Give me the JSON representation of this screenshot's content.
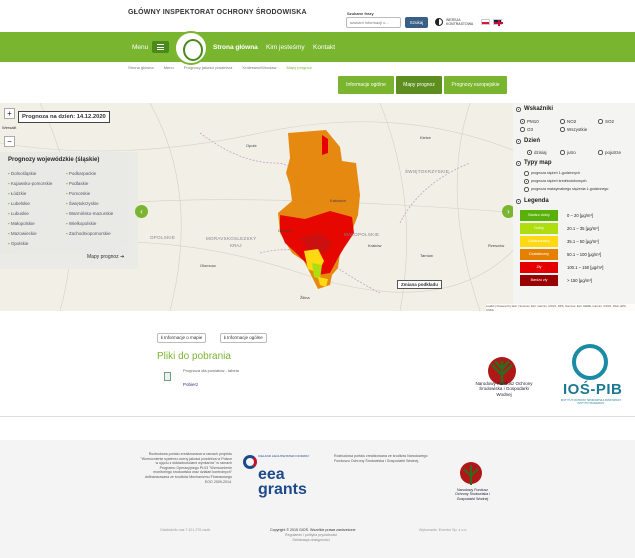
{
  "header": {
    "title": "GŁÓWNY INSPEKTORAT OCHRONY ŚRODOWISKA",
    "search_label": "Szukane frazy",
    "search_placeholder": "szukam informacji o...",
    "search_button": "Szukaj",
    "contrast_label": "WERSJA KONTRASTOWA"
  },
  "nav": {
    "menu": "Menu",
    "items": [
      "Strona główna",
      "Kim jesteśmy",
      "Kontakt"
    ]
  },
  "breadcrumb": [
    "Strona główna",
    "Menu",
    "Prognozy jakości powietrza",
    "Królestwo/Wrocław",
    "Mapy prognoz"
  ],
  "tabs": [
    "Informacje ogólne",
    "Mapy prognoz",
    "Prognozy europejskie"
  ],
  "map": {
    "forecast_date": "Prognoza na dzień: 14.12.2020",
    "zoom_in": "+",
    "zoom_out": "−",
    "lang_word": "Wersalit",
    "change_basemap": "Zmiana podkładu",
    "attribution": "Leaflet | Powered by Esri | Sources: Esri, Garmin, USGS, NPS; Sources: Esri, HERE, Garmin, USGS, NGA, EPA, USDA",
    "place_labels": [
      "OPOLSKIE",
      "ŚWIĘTOKRZYSKIE",
      "MORAVSKOSLEZSKÝ",
      "KRAJ",
      "MAŁOPOLSKIE",
      "Kraków",
      "Opole",
      "Katowice",
      "Kielce",
      "Ostrava",
      "Olomouc",
      "Žilina",
      "Tarnów",
      "Rzeszów"
    ]
  },
  "voivodeships": {
    "title": "Prognozy wojewódzkie (śląskie)",
    "col1": [
      "Dolnośląskie",
      "Kujawsko-pomorskie",
      "Łódzkie",
      "Lubelskie",
      "Lubuskie",
      "Małopolskie",
      "Mazowieckie",
      "Opolskie"
    ],
    "col2": [
      "Podkarpackie",
      "Podlaskie",
      "Pomorskie",
      "Świętokrzyskie",
      "Warmińsko-mazurskie",
      "Wielkopolskie",
      "Zachodniopomorskie"
    ],
    "maps_link": "Mapy prognoz ➔"
  },
  "panel": {
    "indicators_title": "Wskaźniki",
    "indicators": [
      "PM10",
      "NO2",
      "SO2",
      "O3",
      "Wszystkie"
    ],
    "day_title": "Dzień",
    "days": [
      "dzisiaj",
      "jutro",
      "pojutrze"
    ],
    "map_types_title": "Typy map",
    "map_types": [
      "prognoza stężeń 1-godzinnych",
      "prognoza stężeń średniodobowych",
      "prognoza maksymalnego stężenia 1-godzinnego"
    ],
    "legend_title": "Legenda",
    "legend": [
      {
        "label": "Bardzo dobry",
        "value": "0 – 20 [μg/m³]",
        "color": "#57b108"
      },
      {
        "label": "Dobry",
        "value": "20.1 – 35 [μg/m³]",
        "color": "#b0dd10"
      },
      {
        "label": "Umiarkowany",
        "value": "35.1 – 50 [μg/m³]",
        "color": "#ffd911"
      },
      {
        "label": "Dostateczny",
        "value": "50.1 – 100 [μg/m³]",
        "color": "#e58100"
      },
      {
        "label": "Zły",
        "value": "100.1 – 150 [μg/m³]",
        "color": "#e50000"
      },
      {
        "label": "Bardzo zły",
        "value": "> 150 [μg/m³]",
        "color": "#990000"
      }
    ]
  },
  "content": {
    "info_map_btn": "ℹ Informacje o mapie",
    "info_general_btn": "ℹ Informacje ogólne",
    "downloads_title": "Pliki do pobrania",
    "doc_link": "Prognoza dla powiatów - tabela",
    "download_link": "Pobierz",
    "nfos_text": "Narodowy Fundusz Ochrony Środowiska i Gospodarki Wodnej",
    "ios_text": "IOŚ-PIB",
    "ios_sub": "INSTYTUT OCHRONY ŚRODOWISKA PAŃSTWOWY INSTYTUT BADAWCZY"
  },
  "footer": {
    "left_text": "Rozbudowa portalu zrealizowana w ramach projektu \"Wzmocnienie systemu oceny jakości powietrza w Polsce w ujęciu z dokładnościami wymiarów\" w ramach Programu Operacyjnego PL03 \"Wzmocnienie monitoringu środowiska oraz działań kontrolnych\" dofinansowana ze środków Mechanizmu Finansowego EOG 2009-2014.",
    "eea_small": "ICELAND LIECHTENSTEIN NORWAY",
    "eea_text": "eea\ngrants",
    "mid_text": "Rozbudowa portalu zrealizowana ze środków Narodowego Funduszu Ochrony Środowiska i Gospodarki Wodnej.",
    "nfos_small": "Narodowy Fundusz Ochrony Środowiska i Gospodarki Wodnej",
    "counter": "Odwiedziło nas 7 421 276 osób",
    "copyright": "Copyright © 2015 GIOŚ. Wszelkie prawa zastrzeżone",
    "links": "Regulamin i polityka prywatności\nDeklaracja dostępności",
    "made_by": "Wykonanie: Eventur Sp. z o.o."
  }
}
